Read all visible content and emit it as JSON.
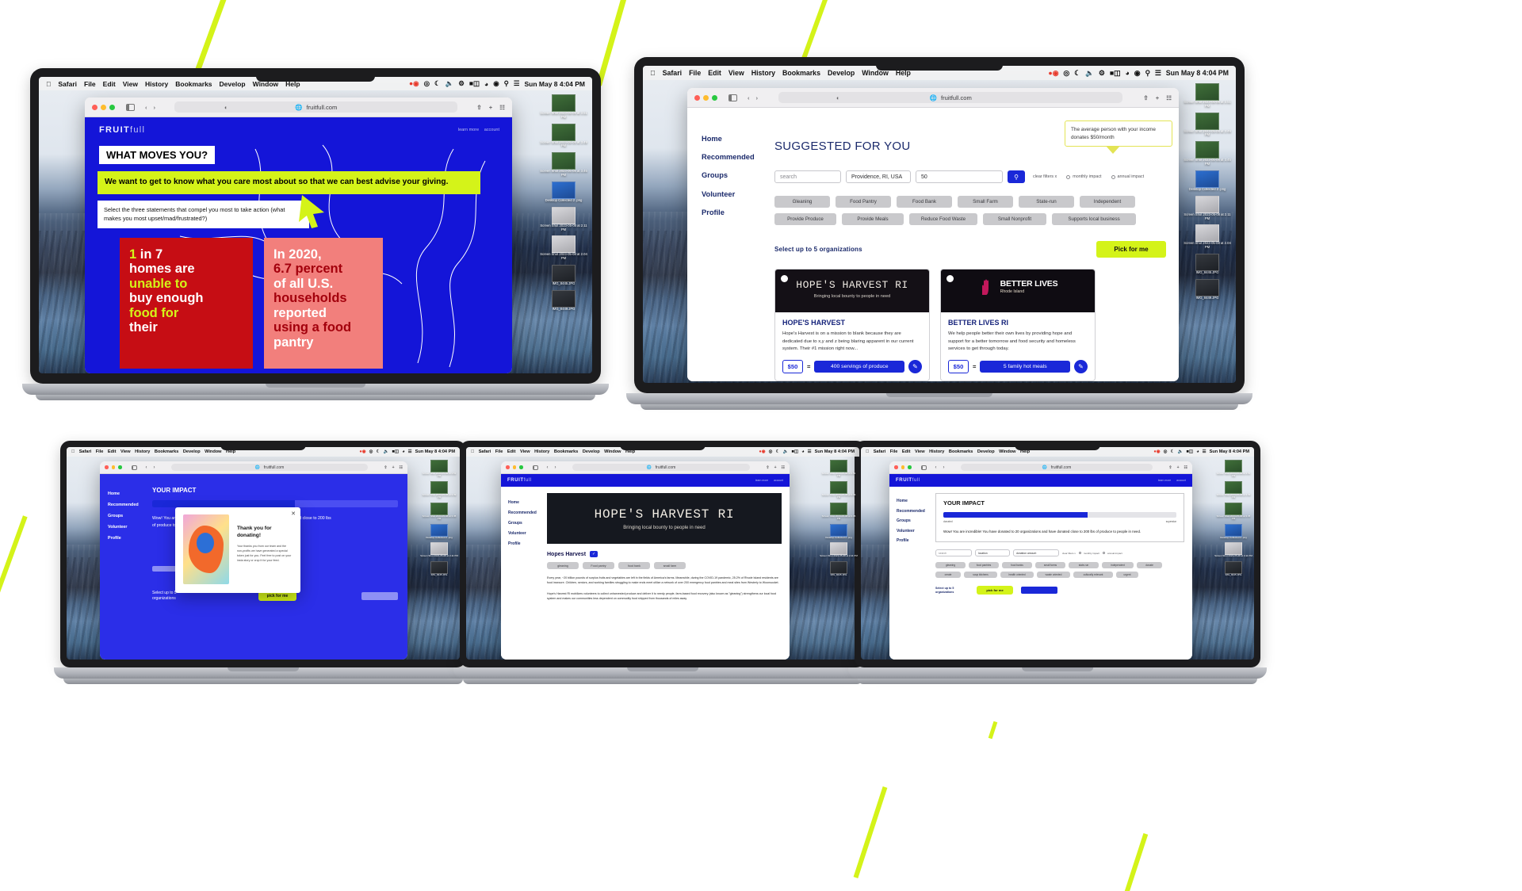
{
  "menubar": {
    "apple": "apple-logo",
    "items": [
      "Safari",
      "File",
      "Edit",
      "View",
      "History",
      "Bookmarks",
      "Develop",
      "Window",
      "Help"
    ],
    "status_icons": [
      "record-icon",
      "shield-icon",
      "moon-icon",
      "volume-icon",
      "bluetooth-icon",
      "battery-icon",
      "wifi-icon",
      "user-icon",
      "search-icon",
      "control-center-icon"
    ],
    "clock": "Sun May 8  4:04 PM"
  },
  "browser": {
    "url": "fruitfull.com",
    "lock_icon": "globe-icon",
    "sidebar_icon": "sidebar-icon",
    "back_icon": "chevron-left-icon",
    "forward_icon": "chevron-right-icon",
    "share_icon": "share-icon",
    "new_tab_icon": "plus-icon",
    "tabs_icon": "tabs-icon",
    "reader_icon": "reader-icon"
  },
  "brand": {
    "bold": "FRUIT",
    "light": "full"
  },
  "nav": {
    "learn_more": "learn more",
    "account": "account"
  },
  "sidebar": {
    "items": [
      "Home",
      "Recommended",
      "Groups",
      "Volunteer",
      "Profile"
    ]
  },
  "screen1": {
    "heading": "WHAT MOVES YOU?",
    "lime_text": "We want to get to know what you care most about so that we can best advise your giving.",
    "instruction": "Select the three statements that compel you most to take action (what makes you most upset/mad/frustrated?)",
    "stats": [
      {
        "lines": [
          {
            "text": "1 ",
            "color": "lime"
          },
          {
            "text": "in 7",
            "color": "white"
          },
          {
            "text": "homes are",
            "color": "white"
          },
          {
            "text": "unable to",
            "color": "lime"
          },
          {
            "text": "buy enough",
            "color": "white"
          },
          {
            "text": "food for",
            "color": "lime"
          },
          {
            "text": "their",
            "color": "white"
          }
        ],
        "bg": "red"
      },
      {
        "lines": [
          {
            "text": "In 2020,",
            "color": "white"
          },
          {
            "text": "6.7 percent",
            "color": "dark"
          },
          {
            "text": "of all U.S.",
            "color": "white"
          },
          {
            "text": "households",
            "color": "dark"
          },
          {
            "text": "reported",
            "color": "white"
          },
          {
            "text": "using a food",
            "color": "dark"
          },
          {
            "text": "pantry",
            "color": "white"
          }
        ],
        "bg": "pink"
      }
    ]
  },
  "screen2": {
    "title": "SUGGESTED FOR YOU",
    "tooltip": "The average person with your income donates $50/month",
    "search_placeholder": "search",
    "location_value": "Providence, RI, USA",
    "amount_value": "50",
    "search_button_icon": "search-icon",
    "clear_filters": "clear filters x",
    "radio_monthly": "monthly impact",
    "radio_annual": "annual impact",
    "tags": [
      "Gleaning",
      "Food Pantry",
      "Food Bank",
      "Small Farm",
      "State-run",
      "Independent",
      "Provide Produce",
      "Provide Meals",
      "Reduce Food Waste",
      "Small Nonprofit",
      "Supports local business"
    ],
    "select_note": "Select up to 5 organizations",
    "pick_for_me": "Pick for me",
    "orgs": [
      {
        "banner_title": "HOPE'S HARVEST RI",
        "banner_sub": "Bringing local bounty to people in need",
        "name": "HOPE'S HARVEST",
        "desc": "Hope's Harvest is on a mission to blank because they are dedicated due to x,y and z being blaring apparent in our current system. Their #1 mission right now...",
        "amount": "$50",
        "equals": "=",
        "impact": "400 servings of produce",
        "action_icon": "edit-icon"
      },
      {
        "banner_title": "BETTER LIVES",
        "banner_sub": "Rhode Island",
        "name": "BETTER LIVES RI",
        "desc": "We help people better their own lives by providing hope and support for a better tomorrow and food security and homeless services to get through today.",
        "amount": "$50",
        "equals": "=",
        "impact": "5 family hot meals",
        "action_icon": "edit-icon"
      }
    ]
  },
  "screen3": {
    "title": "YOUR IMPACT",
    "impact_text": "Wow! You are incredible! You have donated to 20 organizations and have donated close to 200 lbs of produce to people in need.",
    "modal": {
      "close_icon": "close-icon",
      "heading": "Thank you for donating!",
      "body": "Your thanks you from our team and the non-profits we have generated a special token just for you. Feel free to post on your insta story or crop it for your feed.",
      "art": "abstract-artwork"
    },
    "select_note": "Select up to 5 organizations",
    "pick_for_me": "pick for me"
  },
  "screen4": {
    "hero_title": "HOPE'S HARVEST RI",
    "hero_sub": "Bringing local bounty to people in need",
    "org_title": "Hopes Harvest",
    "verified_icon": "verified-badge-icon",
    "chips": [
      "gleaning",
      "Food pantry",
      "food bank",
      "small farm"
    ],
    "paragraphs": [
      "Every year, ~20 billion pounds of surplus fruits and vegetables are left in the fields of America's farms. Meanwhile, during the COVID-19 pandemic, 25.2% of Rhode Island residents are food insecure. Children, seniors, and working families struggling to make ends meet utilize a network of over 200 emergency food pantries and meal sites from Westerly to Woonsocket.",
      "Hope's Harvest RI mobilizes volunteers to collect unharvested produce and deliver it to needy people, farm-based food recovery (also known as \"gleaning\") strengthens our local food system and makes our communities less dependent on commodity food shipped from thousands of miles away"
    ]
  },
  "screen5": {
    "title": "YOUR IMPACT",
    "progress_percent": 62,
    "progress_label_left": "donated",
    "progress_label_right": "superstar",
    "impact_text": "Wow! You are incredible! You have donated to 20 organizations and have donated close to 200 lbs of produce to people in need.",
    "search_placeholder": "search",
    "location_value": "location",
    "amount_value": "donation amount",
    "clear_filters": "clear filters x",
    "monthly": "monthly impact",
    "annual": "annual impact",
    "tags": [
      "gleaning",
      "food pantries",
      "food banks",
      "small farms",
      "state-run",
      "independent",
      "donate",
      "create",
      "soup kitchens",
      "health oriented",
      "waste oriented",
      "culturally relevant",
      "urgent"
    ],
    "select_note": "Select up to 5 organizations",
    "pick_for_me": "pick for me"
  },
  "desktop_files": [
    {
      "label": "Screen Shot 2023-05-08 at 3.51 PM",
      "thumb": "green"
    },
    {
      "label": "Screen Shot 2023-05-08 at 3.49 PM",
      "thumb": "green"
    },
    {
      "label": "Screen Shot 2023-05-08 at 3.45 PM",
      "thumb": "green"
    },
    {
      "label": "Desktop Collected 2 .png",
      "thumb": "blue"
    },
    {
      "label": "Screen Shot 2023-05-08 at 2.11 PM",
      "thumb": "gray"
    },
    {
      "label": "Screen Shot 2023-05-08 at 2.04 PM",
      "thumb": "gray"
    },
    {
      "label": "IMG_8445.JPG",
      "thumb": "dark"
    },
    {
      "label": "IMG_8449.JPG",
      "thumb": "dark"
    }
  ],
  "colors": {
    "brand_blue": "#1a28d8",
    "lime": "#d4f319",
    "red": "#c60d14",
    "pink": "#f27f7c",
    "navy": "#1b2a6b"
  }
}
